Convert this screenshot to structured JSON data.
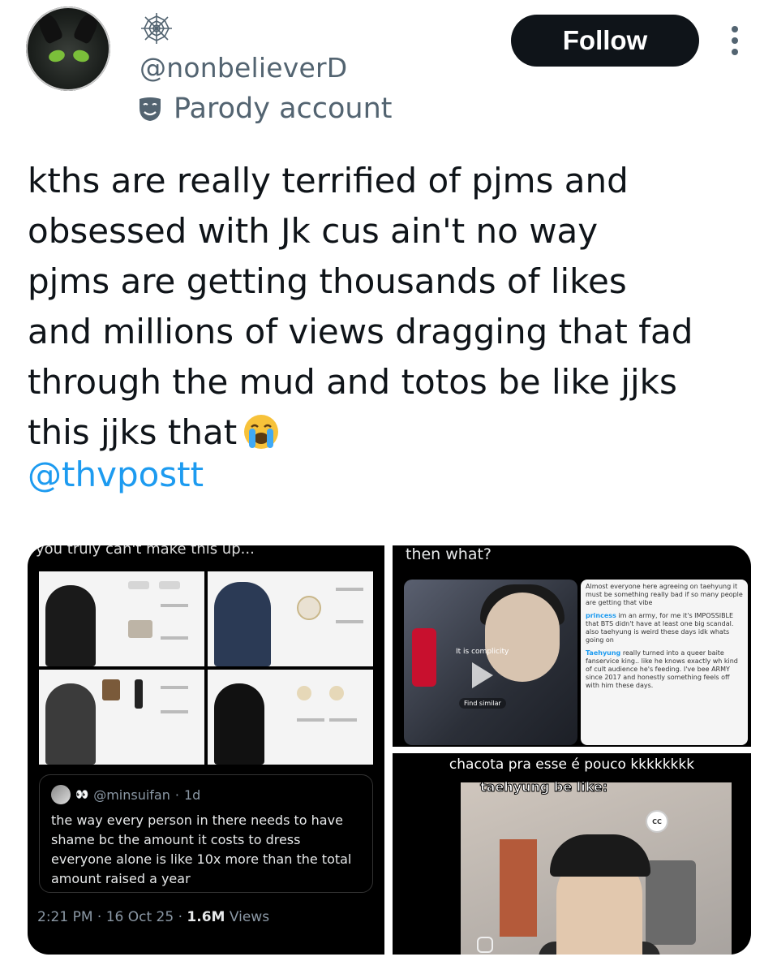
{
  "author": {
    "handle": "@nonbelieverD",
    "parody_label": "Parody account",
    "label_icon": "spider-web-icon",
    "parody_icon": "theater-mask-icon"
  },
  "actions": {
    "follow_label": "Follow",
    "more_icon": "more-vertical-icon"
  },
  "tweet": {
    "lines": [
      "kths are really terrified of pjms and",
      "obsessed with Jk cus ain't no way",
      "pjms are getting thousands of likes",
      "and millions of views dragging that fad",
      "through the mud and totos be like jjks",
      "this jjks that"
    ],
    "emoji": "loudly-crying-face",
    "mention": "@thvpostt"
  },
  "media": {
    "panel1": {
      "caption": "you truly can't make this up...",
      "quote": {
        "user": "@minsuifan",
        "time": "1d",
        "text": "the way every person in there needs to have shame bc the amount it costs to dress everyone alone is like 10x more than the total amount raised a year"
      },
      "time": "2:21 PM",
      "date": "16 Oct 25",
      "views_count": "1.6M",
      "views_label": "Views"
    },
    "panel2": {
      "caption": "then what?",
      "video_label": "It is complicity",
      "find_similar": "Find similar",
      "comments": [
        {
          "user": "",
          "text": "Almost everyone here agreeing on taehyung it must be something really bad if so many people are getting that vibe"
        },
        {
          "user": "princess",
          "text": "im an army, for me it's IMPOSSIBLE that BTS didn't have at least one big scandal. also taehyung is weird these days idk whats going on"
        },
        {
          "user": "Taehyung",
          "text": "really turned into a queer baite fanservice king.. like he knows exactly wh kind of cult audience he's feeding. I've bee ARMY since 2017 and honestly something feels off with him these days."
        }
      ]
    },
    "panel3": {
      "caption": "chacota pra esse é pouco kkkkkkkk",
      "subtitle": "taehyung be like:",
      "cc_label": "CC"
    }
  }
}
